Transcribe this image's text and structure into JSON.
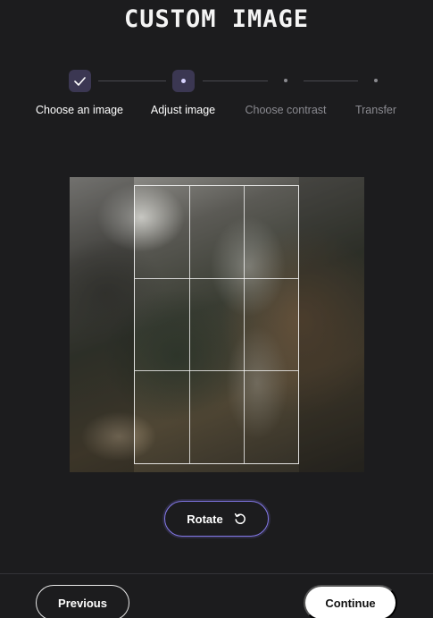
{
  "header": {
    "title": "CUSTOM IMAGE"
  },
  "stepper": {
    "steps": [
      {
        "label": "Choose an image",
        "state": "completed"
      },
      {
        "label": "Adjust image",
        "state": "current"
      },
      {
        "label": "Choose contrast",
        "state": "pending"
      },
      {
        "label": "Transfer",
        "state": "pending"
      }
    ]
  },
  "cropper": {
    "image_description_icon": "mountain-photo",
    "grid_rows": 3,
    "grid_columns": 3
  },
  "actions": {
    "rotate_label": "Rotate",
    "rotate_icon": "rotate-ccw-icon",
    "previous_label": "Previous",
    "continue_label": "Continue"
  },
  "colors": {
    "background": "#1c1c1e",
    "accent": "#8378e8",
    "step_marker": "#3b3752"
  }
}
